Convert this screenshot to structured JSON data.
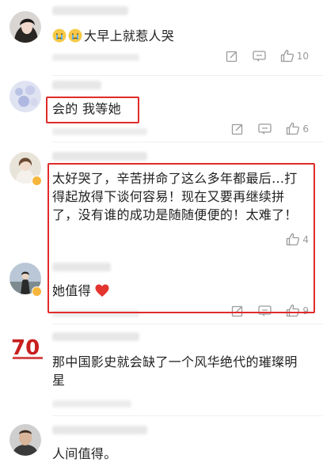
{
  "comments": [
    {
      "text": "大早上就惹人哭",
      "like_count": "10"
    },
    {
      "text": "会的 我等她",
      "like_count": "6"
    },
    {
      "text_line1": "太好哭了，辛苦拼命了这么多年都最后...打",
      "text_line2": "得起放得下谈何容易！现在又要再继续拼",
      "text_line3": "了，没有谁的成功是随随便便的！太难了！",
      "like_count": "4"
    },
    {
      "text": "她值得",
      "like_count": "9"
    },
    {
      "text_line1": "那中国影史就会缺了一个风华绝代的璀璨明",
      "text_line2": "星"
    },
    {
      "text": "人间值得。"
    }
  ],
  "icons": {
    "reply": "edit-square-icon",
    "comment": "comment-icon",
    "like": "thumbs-up-icon",
    "emoji_crying": "crying-face-icon",
    "emoji_heart": "red-heart-icon"
  },
  "colors": {
    "highlight_box": "#e02b2b",
    "meta_gray": "#9a9a9a",
    "verified_badge": "#f6b53b"
  }
}
